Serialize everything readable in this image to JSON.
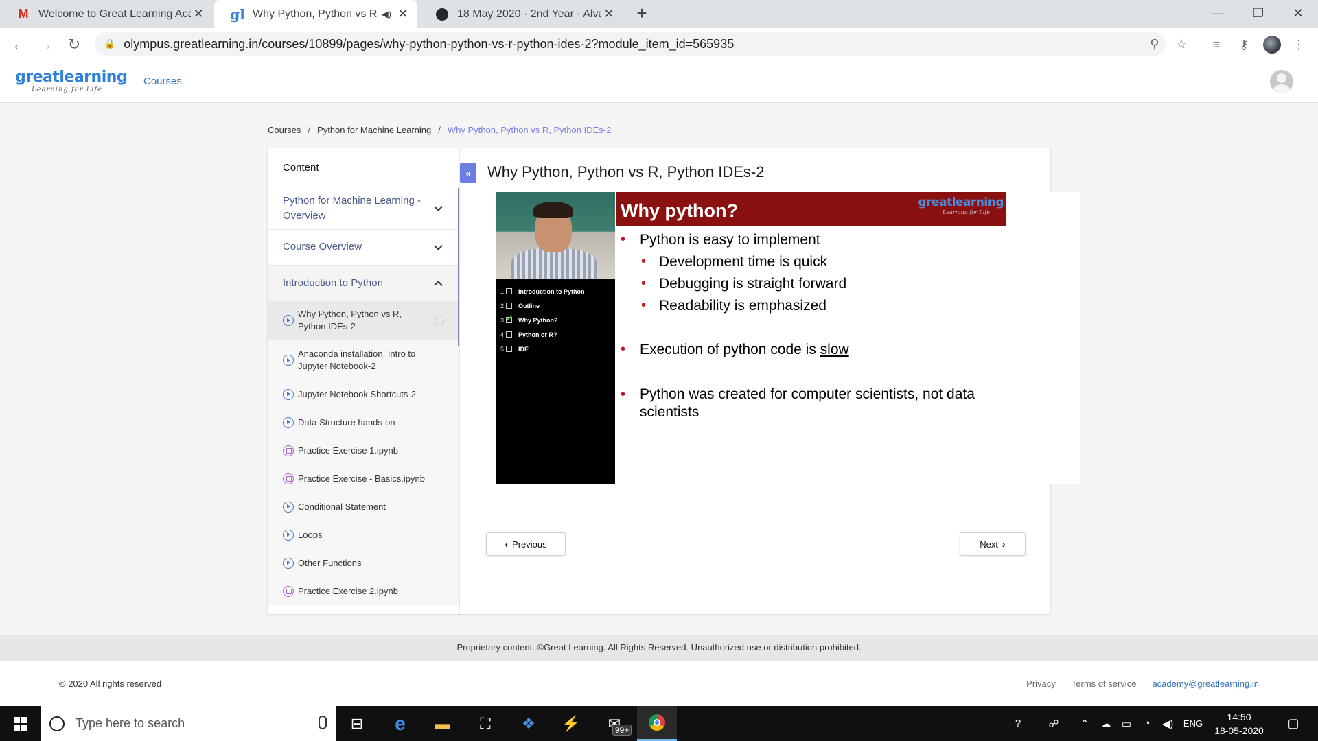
{
  "browser": {
    "tabs": [
      {
        "title": "Welcome to Great Learning Acad",
        "favicon": "gmail-icon",
        "active": false
      },
      {
        "title": "Why Python, Python vs R, Py",
        "favicon": "greatlearning-icon",
        "active": true,
        "audio": true
      },
      {
        "title": "18 May 2020 · 2nd Year · Alva's E",
        "favicon": "github-icon",
        "active": false
      }
    ],
    "new_tab": "+",
    "url": "olympus.greatlearning.in/courses/10899/pages/why-python-python-vs-r-python-ides-2?module_item_id=565935"
  },
  "site": {
    "logo_brand": "greatlearning",
    "logo_tagline": "Learning for Life",
    "nav_courses": "Courses"
  },
  "breadcrumb": [
    "Courses",
    "Python for Machine Learning",
    "Why Python, Python vs R, Python IDEs-2"
  ],
  "sidebar": {
    "heading": "Content",
    "modules": [
      {
        "label": "Python for Machine Learning - Overview",
        "expanded": false
      },
      {
        "label": "Course Overview",
        "expanded": false
      },
      {
        "label": "Introduction to Python",
        "expanded": true
      }
    ],
    "items": [
      {
        "label": "Why Python, Python vs R, Python IDEs-2",
        "type": "video",
        "active": true
      },
      {
        "label": "Anaconda installation, Intro to Jupyter Notebook-2",
        "type": "video"
      },
      {
        "label": "Jupyter Notebook Shortcuts-2",
        "type": "video"
      },
      {
        "label": "Data Structure hands-on",
        "type": "video"
      },
      {
        "label": "Practice Exercise 1.ipynb",
        "type": "notebook"
      },
      {
        "label": "Practice Exercise - Basics.ipynb",
        "type": "notebook"
      },
      {
        "label": "Conditional Statement",
        "type": "video"
      },
      {
        "label": "Loops",
        "type": "video"
      },
      {
        "label": "Other Functions",
        "type": "video"
      },
      {
        "label": "Practice Exercise 2.ipynb",
        "type": "notebook"
      }
    ]
  },
  "content": {
    "collapse_label": "«",
    "title": "Why Python, Python vs R, Python IDEs-2",
    "slide": {
      "heading": "Why python?",
      "brand": "greatlearning",
      "brand_tagline": "Learning for Life",
      "outline": [
        {
          "n": "1",
          "label": "Introduction to Python",
          "checked": false
        },
        {
          "n": "2",
          "label": "Outline",
          "checked": false
        },
        {
          "n": "3",
          "label": "Why Python?",
          "checked": true
        },
        {
          "n": "4",
          "label": "Python or R?",
          "checked": false
        },
        {
          "n": "5",
          "label": "IDE",
          "checked": false
        }
      ],
      "b1": "Python is easy to implement",
      "b1a": "Development time is quick",
      "b1b": "Debugging is straight forward",
      "b1c": "Readability is emphasized",
      "b2_pre": "Execution of python code is ",
      "b2_emph": "slow",
      "b3_line1": "Python was created for computer scientists, not data",
      "b3_line2": "scientists"
    },
    "prev_label": "Previous",
    "next_label": "Next"
  },
  "notice": "Proprietary content. ©Great Learning. All Rights Reserved. Unauthorized use or distribution prohibited.",
  "footer": {
    "copyright": "© 2020 All rights reserved",
    "privacy": "Privacy",
    "terms": "Terms of service",
    "email": "academy@greatlearning.in"
  },
  "taskbar": {
    "search_placeholder": "Type here to search",
    "badge": "99+",
    "lang": "ENG",
    "time": "14:50",
    "date": "18-05-2020"
  },
  "colors": {
    "accent": "#6d7ee3",
    "slide_header": "#8b1010",
    "link": "#2f6fbf"
  }
}
